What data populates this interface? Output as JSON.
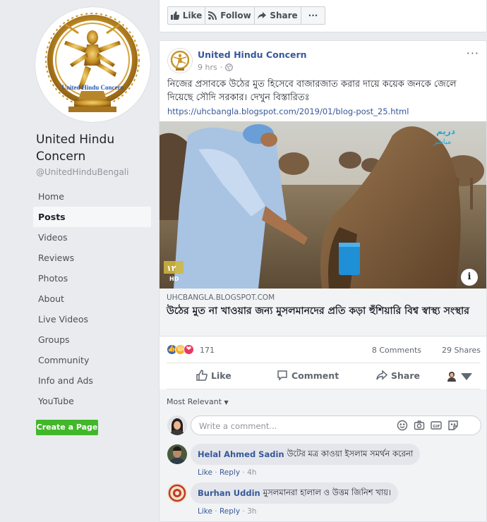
{
  "page": {
    "name": "United Hindu Concern",
    "handle": "@UnitedHinduBengali",
    "logo_text": "United Hindu Concern"
  },
  "nav": {
    "items": [
      {
        "label": "Home"
      },
      {
        "label": "Posts"
      },
      {
        "label": "Videos"
      },
      {
        "label": "Reviews"
      },
      {
        "label": "Photos"
      },
      {
        "label": "About"
      },
      {
        "label": "Live Videos"
      },
      {
        "label": "Groups"
      },
      {
        "label": "Community"
      },
      {
        "label": "Info and Ads"
      },
      {
        "label": "YouTube"
      }
    ],
    "active": "Posts"
  },
  "create_page_label": "Create a Page",
  "top_actions": {
    "like": "Like",
    "follow": "Follow",
    "share": "Share",
    "more": "···"
  },
  "post": {
    "author": "United Hindu Concern",
    "time": "9 hrs",
    "text": "নিজের প্রসাবকে উঠের মুত হিসেবে বাজারজাত করার দায়ে কয়েক জনকে জেলে দিয়েছে সৌদি সরকার। দেখুন বিস্তারিতঃ",
    "link": "https://uhcbangla.blogspot.com/2019/01/blog-post_25.html",
    "link_domain": "UHCBANGLA.BLOGSPOT.COM",
    "link_title": "উঠের মুত না খাওয়ার জন্য মুসলমানদের প্রতি কড়া হুঁশিয়ারি বিশ্ব স্বাস্থ্য সংস্থার",
    "info_icon": "i",
    "reactions_count": "171",
    "comments_count": "8 Comments",
    "shares_count": "29 Shares"
  },
  "actions": {
    "like": "Like",
    "comment": "Comment",
    "share": "Share"
  },
  "comments": {
    "sort_label": "Most Relevant",
    "placeholder": "Write a comment...",
    "list": [
      {
        "name": "Helal Ahmed Sadin",
        "text": "উটের মত্র কাওয়া ইসলাম সমর্থন করেনা",
        "like": "Like",
        "reply": "Reply",
        "time": "4h"
      },
      {
        "name": "Burhan Uddin",
        "text": "মুসলমানরা হালাল ও উত্তম জিনিশ খায়।",
        "like": "Like",
        "reply": "Reply",
        "time": "3h"
      }
    ]
  },
  "video_watermark": {
    "tl": "دريم",
    "tr": "مباشر",
    "hd": "HD"
  },
  "colors": {
    "link": "#385898",
    "green": "#42b72a",
    "bg": "#e9ebee"
  }
}
